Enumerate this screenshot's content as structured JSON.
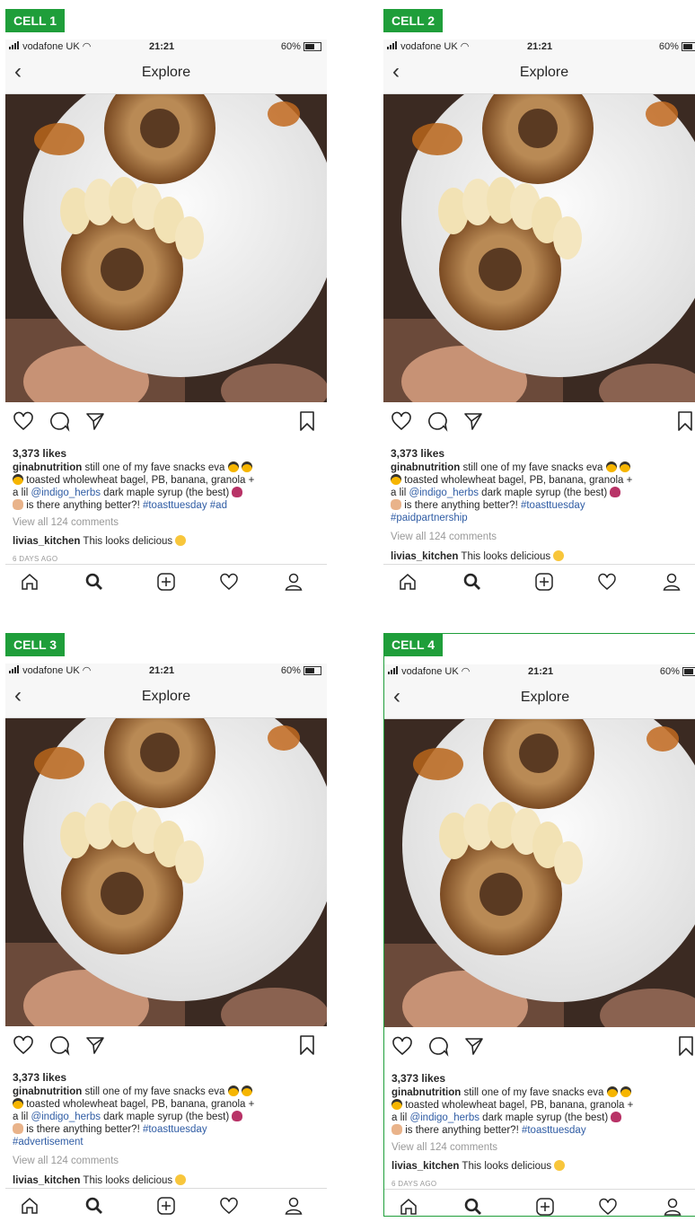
{
  "status": {
    "carrier": "vodafone UK",
    "time": "21:21",
    "battery": "60%"
  },
  "nav": {
    "back_icon": "chevron-left-icon",
    "title": "Explore"
  },
  "colors": {
    "label_green": "#1f9e3a",
    "link_blue": "#2f5ca4",
    "muted": "#999999"
  },
  "cells": [
    {
      "label": "CELL 1",
      "likes": "3,373 likes",
      "username": "ginabnutrition",
      "caption_a": " still one of my fave snacks eva ",
      "caption_b": " toasted wholewheat bagel, PB, banana, granola +",
      "caption_c1": "a lil ",
      "mention": "@indigo_herbs",
      "caption_c2": " dark maple syrup (the best) ",
      "caption_d": " is there anything better?! ",
      "hashtag": "#toasttuesday",
      "disclosure": " #ad",
      "view_comments": "View all 124 comments",
      "commenter": "livias_kitchen",
      "comment_text": " This looks delicious ",
      "date": "6 DAYS AGO"
    },
    {
      "label": "CELL 2",
      "likes": "3,373 likes",
      "username": "ginabnutrition",
      "caption_a": " still one of my fave snacks eva ",
      "caption_b": " toasted wholewheat bagel, PB, banana, granola +",
      "caption_c1": "a lil ",
      "mention": "@indigo_herbs",
      "caption_c2": " dark maple syrup (the best) ",
      "caption_d": " is there anything better?! ",
      "hashtag": "#toasttuesday",
      "disclosure": "#paidpartnership",
      "view_comments": "View all 124 comments",
      "commenter": "livias_kitchen",
      "comment_text": " This looks delicious "
    },
    {
      "label": "CELL 3",
      "likes": "3,373 likes",
      "username": "ginabnutrition",
      "caption_a": " still one of my fave snacks eva ",
      "caption_b": " toasted wholewheat bagel, PB, banana, granola +",
      "caption_c1": "a lil ",
      "mention": "@indigo_herbs",
      "caption_c2": " dark maple syrup (the best) ",
      "caption_d": " is there anything better?! ",
      "hashtag": "#toasttuesday",
      "disclosure": "#advertisement",
      "view_comments": "View all 124 comments",
      "commenter": "livias_kitchen",
      "comment_text": " This looks delicious "
    },
    {
      "label": "CELL 4",
      "likes": "3,373 likes",
      "username": "ginabnutrition",
      "caption_a": " still one of my fave snacks eva ",
      "caption_b": " toasted wholewheat bagel, PB, banana, granola +",
      "caption_c1": "a lil ",
      "mention": "@indigo_herbs",
      "caption_c2": " dark maple syrup (the best) ",
      "caption_d": " is there anything better?! ",
      "hashtag": "#toasttuesday",
      "view_comments": "View all 124 comments",
      "commenter": "livias_kitchen",
      "comment_text": " This looks delicious ",
      "date": "6 DAYS AGO"
    }
  ],
  "tabbar_icons": [
    "home-icon",
    "search-icon",
    "add-post-icon",
    "activity-heart-icon",
    "profile-icon"
  ],
  "action_icons": [
    "like-heart-icon",
    "comment-icon",
    "share-icon",
    "bookmark-icon"
  ]
}
